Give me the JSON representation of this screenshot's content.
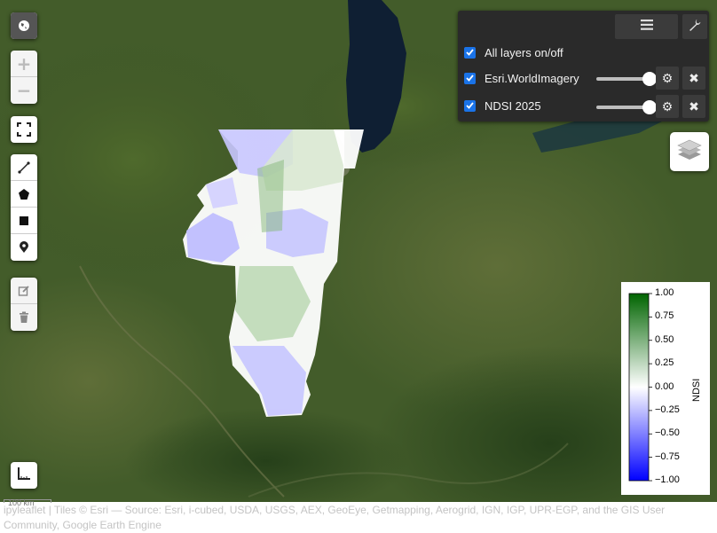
{
  "map": {
    "attribution": "ipyleaflet | Tiles © Esri — Source: Esri, i-cubed, USDA, USGS, AEX, GeoEye, Getmapping, Aerogrid, IGN, IGP, UPR-EGP, and the GIS User Community, Google Earth Engine",
    "scale_label": "100 km"
  },
  "left_controls": {
    "globe": "globe-icon",
    "zoom_in": "+",
    "zoom_out": "−",
    "fullscreen": "fullscreen-icon",
    "draw_tools": [
      "polyline-icon",
      "polygon-icon",
      "rectangle-icon",
      "marker-icon"
    ],
    "edit_tools": [
      "edit-icon",
      "trash-icon"
    ]
  },
  "layer_manager": {
    "rows": [
      {
        "label": "All layers on/off",
        "checked": true
      },
      {
        "label": "Esri.WorldImagery",
        "checked": true,
        "opacity": 1.0
      },
      {
        "label": "NDSI 2025",
        "checked": true,
        "opacity": 1.0
      }
    ]
  },
  "legend": {
    "title": "NDSI",
    "ticks": [
      "1.00",
      "0.75",
      "0.50",
      "0.25",
      "0.00",
      "−0.25",
      "−0.50",
      "−0.75",
      "−1.00"
    ],
    "vmin": -1.0,
    "vmax": 1.0,
    "colors": {
      "low": "#0000ff",
      "mid": "#ffffff",
      "high": "#006400"
    }
  }
}
